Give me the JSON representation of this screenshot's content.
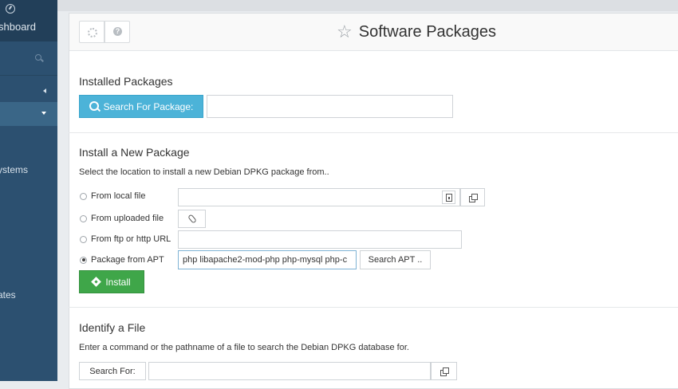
{
  "sidebar": {
    "dashboard_label": "shboard",
    "item_systems": "ystems",
    "item_updates": "ates"
  },
  "header": {
    "title": "Software Packages",
    "help_glyph": "?"
  },
  "installed": {
    "title": "Installed Packages",
    "search_button": "Search For Package:",
    "search_value": ""
  },
  "install_new": {
    "title": "Install a New Package",
    "description": "Select the location to install a new Debian DPKG package from..",
    "options": [
      {
        "label": "From local file",
        "selected": false,
        "value": ""
      },
      {
        "label": "From uploaded file",
        "selected": false
      },
      {
        "label": "From ftp or http URL",
        "selected": false,
        "value": ""
      },
      {
        "label": "Package from APT",
        "selected": true,
        "value": "php libapache2-mod-php php-mysql php-c"
      }
    ],
    "search_apt_button": "Search APT ..",
    "install_button": "Install"
  },
  "identify": {
    "title": "Identify a File",
    "description": "Enter a command or the pathname of a file to search the Debian DPKG database for.",
    "search_label": "Search For:",
    "search_value": ""
  },
  "colors": {
    "sidebar": "#2c5070",
    "search_button": "#4cb3d8",
    "install_button": "#3fa649"
  }
}
